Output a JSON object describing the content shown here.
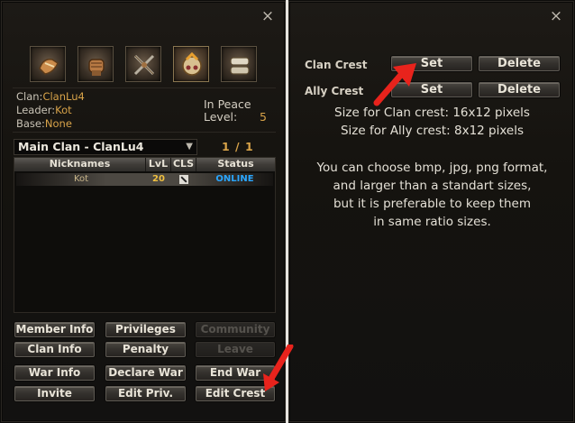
{
  "left_panel": {
    "close": "×",
    "crest_icons": [
      "scroll-hand-icon",
      "fist-icon",
      "crossed-swords-icon",
      "rank-up-icon",
      "scrolls-icon"
    ],
    "clan_label": "Clan:",
    "clan_value": "ClanLu4",
    "leader_label": "Leader:",
    "leader_value": "Kot",
    "base_label": "Base:",
    "base_value": "None",
    "peace_status": "In Peace",
    "level_label": "Level:",
    "level_value": "5",
    "clan_select": {
      "selected": "Main Clan - ClanLu4"
    },
    "pager": "1 / 1",
    "table": {
      "headers": [
        "Nicknames",
        "LvL",
        "CLS",
        "Status"
      ],
      "rows": [
        {
          "nickname": "Kot",
          "level": "20",
          "status": "ONLINE"
        }
      ]
    },
    "buttons": {
      "member_info": "Member Info",
      "privileges": "Privileges",
      "community": "Community",
      "clan_info": "Clan Info",
      "penalty": "Penalty",
      "leave": "Leave",
      "war_info": "War Info",
      "declare_war": "Declare War",
      "end_war": "End War",
      "invite": "Invite",
      "edit_priv": "Edit Priv.",
      "edit_crest": "Edit Crest"
    }
  },
  "right_panel": {
    "close": "×",
    "clan_crest_label": "Clan Crest",
    "ally_crest_label": "Ally Crest",
    "set_label": "Set",
    "delete_label": "Delete",
    "size_clan": "Size for Clan crest: 16x12 pixels",
    "size_ally": "Size for Ally crest: 8x12 pixels",
    "note_lines": [
      "You can choose bmp, jpg, png format,",
      "and larger than a standart sizes,",
      "but it is preferable to keep them",
      "in same ratio sizes."
    ]
  },
  "colors": {
    "accent_gold": "#d8a349",
    "online_blue": "#2aa6ff",
    "arrow_red": "#e8231c"
  }
}
